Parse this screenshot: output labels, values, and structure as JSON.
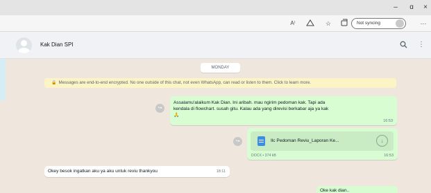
{
  "browser": {
    "window_controls": {
      "minimize": "–",
      "maximize": "ɑ",
      "close": "×"
    },
    "toolbar": {
      "read_aloud_icon": "A⁾",
      "sync_label": "Not syncing",
      "more": "···"
    }
  },
  "chat": {
    "contact_name": "Kak Dian SPI",
    "date_chip": "MONDAY",
    "encryption_notice": "Messages are end-to-end encrypted. No one outside of this chat, not even WhatsApp, can read or listen to them. Click to learn more.",
    "messages": [
      {
        "direction": "out",
        "text_line1": "Assalamu'alaikum Kak Dian. Ini aribah. mau ngirim pedoman kak. Tapi ada",
        "text_line2": "kendala di flowchart. susah gitu. Kalau ada yang direvisi berkabar aja ya kak",
        "emoji": "🙏",
        "time": "16:53"
      },
      {
        "direction": "out",
        "doc_name": "Ilc Pedoman Reviu_Laporan Ke...",
        "doc_meta": "DOCX • 374 kB",
        "time": "16:53"
      },
      {
        "direction": "in",
        "text": "Okey besok ingatkan aku ya aku untuk reviu thankyou",
        "time": "18:11"
      },
      {
        "direction": "out",
        "text": "Oke kak dian..",
        "time": ""
      }
    ]
  },
  "colors": {
    "outgoing_bubble": "#d9fdd3",
    "incoming_bubble": "#ffffff",
    "chat_background": "#efe7dd",
    "notice_background": "#fdf4c5",
    "doc_icon": "#3c8ee5"
  },
  "icons": [
    "minimize-icon",
    "maximize-icon",
    "close-icon",
    "read-aloud-icon",
    "immersive-reader-icon",
    "favorites-icon",
    "collections-icon",
    "profile-icon",
    "more-icon",
    "avatar-icon",
    "search-icon",
    "menu-icon",
    "lock-icon",
    "forward-icon",
    "document-icon",
    "download-icon"
  ]
}
